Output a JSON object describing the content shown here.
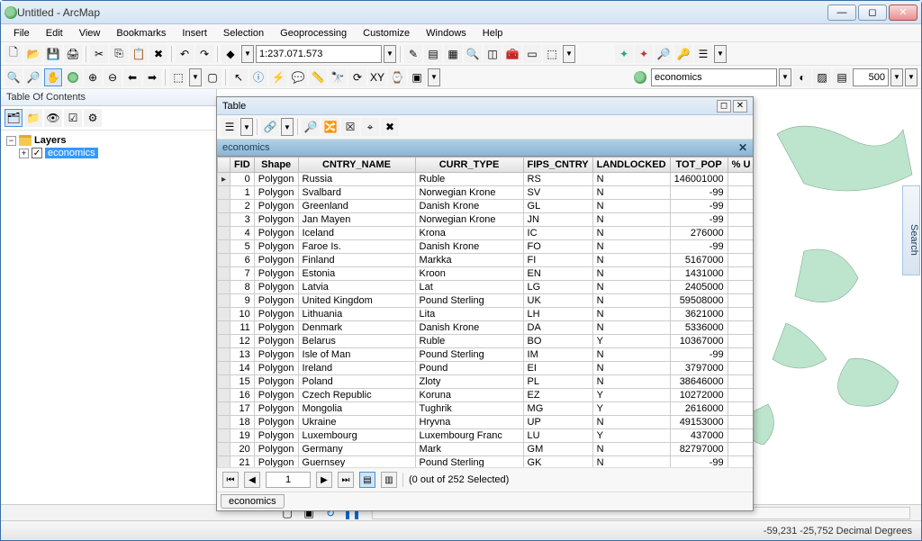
{
  "window": {
    "title": "Untitled - ArcMap"
  },
  "menubar": [
    "File",
    "Edit",
    "View",
    "Bookmarks",
    "Insert",
    "Selection",
    "Geoprocessing",
    "Customize",
    "Windows",
    "Help"
  ],
  "toolbar1": {
    "scale": "1:237.071.573"
  },
  "toolbar2": {
    "layer_dropdown": "economics",
    "num_box": "500"
  },
  "toc": {
    "header": "Table Of Contents",
    "root": "Layers",
    "items": [
      "economics"
    ]
  },
  "table_window": {
    "title": "Table",
    "layer_name": "economics",
    "columns": [
      "FID",
      "Shape",
      "CNTRY_NAME",
      "CURR_TYPE",
      "FIPS_CNTRY",
      "LANDLOCKED",
      "TOT_POP",
      "% U"
    ],
    "rows": [
      {
        "fid": 0,
        "shape": "Polygon",
        "name": "Russia",
        "curr": "Ruble",
        "fips": "RS",
        "land": "N",
        "pop": 146001000
      },
      {
        "fid": 1,
        "shape": "Polygon",
        "name": "Svalbard",
        "curr": "Norwegian Krone",
        "fips": "SV",
        "land": "N",
        "pop": -99
      },
      {
        "fid": 2,
        "shape": "Polygon",
        "name": "Greenland",
        "curr": "Danish Krone",
        "fips": "GL",
        "land": "N",
        "pop": -99
      },
      {
        "fid": 3,
        "shape": "Polygon",
        "name": "Jan Mayen",
        "curr": "Norwegian Krone",
        "fips": "JN",
        "land": "N",
        "pop": -99
      },
      {
        "fid": 4,
        "shape": "Polygon",
        "name": "Iceland",
        "curr": "Krona",
        "fips": "IC",
        "land": "N",
        "pop": 276000
      },
      {
        "fid": 5,
        "shape": "Polygon",
        "name": "Faroe Is.",
        "curr": "Danish Krone",
        "fips": "FO",
        "land": "N",
        "pop": -99
      },
      {
        "fid": 6,
        "shape": "Polygon",
        "name": "Finland",
        "curr": "Markka",
        "fips": "FI",
        "land": "N",
        "pop": 5167000
      },
      {
        "fid": 7,
        "shape": "Polygon",
        "name": "Estonia",
        "curr": "Kroon",
        "fips": "EN",
        "land": "N",
        "pop": 1431000
      },
      {
        "fid": 8,
        "shape": "Polygon",
        "name": "Latvia",
        "curr": "Lat",
        "fips": "LG",
        "land": "N",
        "pop": 2405000
      },
      {
        "fid": 9,
        "shape": "Polygon",
        "name": "United Kingdom",
        "curr": "Pound Sterling",
        "fips": "UK",
        "land": "N",
        "pop": 59508000
      },
      {
        "fid": 10,
        "shape": "Polygon",
        "name": "Lithuania",
        "curr": "Lita",
        "fips": "LH",
        "land": "N",
        "pop": 3621000
      },
      {
        "fid": 11,
        "shape": "Polygon",
        "name": "Denmark",
        "curr": "Danish Krone",
        "fips": "DA",
        "land": "N",
        "pop": 5336000
      },
      {
        "fid": 12,
        "shape": "Polygon",
        "name": "Belarus",
        "curr": "Ruble",
        "fips": "BO",
        "land": "Y",
        "pop": 10367000
      },
      {
        "fid": 13,
        "shape": "Polygon",
        "name": "Isle of Man",
        "curr": "Pound Sterling",
        "fips": "IM",
        "land": "N",
        "pop": -99
      },
      {
        "fid": 14,
        "shape": "Polygon",
        "name": "Ireland",
        "curr": "Pound",
        "fips": "EI",
        "land": "N",
        "pop": 3797000
      },
      {
        "fid": 15,
        "shape": "Polygon",
        "name": "Poland",
        "curr": "Zloty",
        "fips": "PL",
        "land": "N",
        "pop": 38646000
      },
      {
        "fid": 16,
        "shape": "Polygon",
        "name": "Czech Republic",
        "curr": "Koruna",
        "fips": "EZ",
        "land": "Y",
        "pop": 10272000
      },
      {
        "fid": 17,
        "shape": "Polygon",
        "name": "Mongolia",
        "curr": "Tughrik",
        "fips": "MG",
        "land": "Y",
        "pop": 2616000
      },
      {
        "fid": 18,
        "shape": "Polygon",
        "name": "Ukraine",
        "curr": "Hryvna",
        "fips": "UP",
        "land": "N",
        "pop": 49153000
      },
      {
        "fid": 19,
        "shape": "Polygon",
        "name": "Luxembourg",
        "curr": "Luxembourg Franc",
        "fips": "LU",
        "land": "Y",
        "pop": 437000
      },
      {
        "fid": 20,
        "shape": "Polygon",
        "name": "Germany",
        "curr": "Mark",
        "fips": "GM",
        "land": "N",
        "pop": 82797000
      },
      {
        "fid": 21,
        "shape": "Polygon",
        "name": "Guernsey",
        "curr": "Pound Sterling",
        "fips": "GK",
        "land": "N",
        "pop": -99
      }
    ],
    "nav": {
      "current": "1",
      "status": "(0 out of 252 Selected)"
    },
    "tab": "economics"
  },
  "search_tab": "Search",
  "statusbar": {
    "coords": "-59,231 -25,752 Decimal Degrees"
  }
}
